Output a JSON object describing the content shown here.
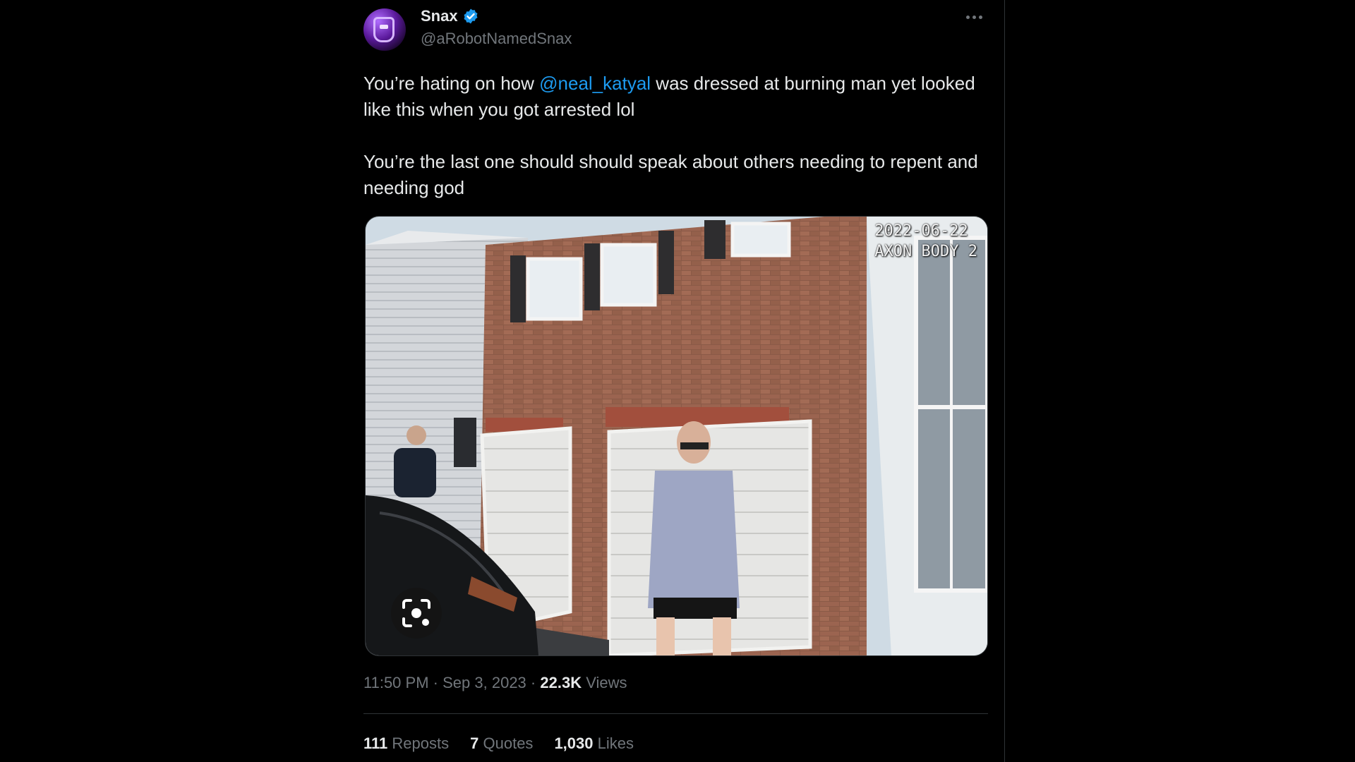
{
  "author": {
    "name": "Snax",
    "handle": "@aRobotNamedSnax",
    "verified": true,
    "verified_color": "#1d9bf0"
  },
  "tweet": {
    "line1_before": "You’re hating on how ",
    "mention": "@neal_katyal",
    "line1_after": " was dressed at burning man yet looked like this when you got arrested lol",
    "paragraph2": "You’re the last one should should speak about others needing to repent and needing god"
  },
  "media": {
    "overlay_date": "2022-06-22",
    "overlay_device": "AXON BODY 2",
    "lens_icon": "google-lens-icon"
  },
  "meta": {
    "time": "11:50 PM",
    "separator": "·",
    "date": "Sep 3, 2023",
    "views_count": "22.3K",
    "views_label": "Views"
  },
  "stats": {
    "reposts_count": "111",
    "reposts_label": "Reposts",
    "quotes_count": "7",
    "quotes_label": "Quotes",
    "likes_count": "1,030",
    "likes_label": "Likes"
  },
  "colors": {
    "background": "#000000",
    "text": "#e7e9ea",
    "muted": "#71767b",
    "link": "#1d9bf0",
    "border": "#2f3336"
  }
}
